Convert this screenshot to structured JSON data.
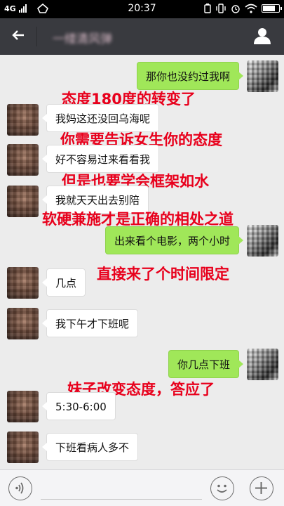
{
  "status_bar": {
    "network": "4G",
    "time": "20:37",
    "battery_level": 0.85
  },
  "header": {
    "title": "一缕清风弹",
    "back_icon": "back-arrow-icon",
    "profile_icon": "profile-icon"
  },
  "messages": [
    {
      "side": "self",
      "text": "那你也没约过我啊"
    },
    {
      "side": "other",
      "text": "我妈这还没回乌海呢"
    },
    {
      "side": "other",
      "text": "好不容易过来看看我"
    },
    {
      "side": "other",
      "text": "我就天天出去别陪"
    },
    {
      "side": "self",
      "text": "出来看个电影，两个小时"
    },
    {
      "side": "other",
      "text": "几点"
    },
    {
      "side": "other",
      "text": "我下午才下班呢"
    },
    {
      "side": "self",
      "text": "你几点下班"
    },
    {
      "side": "other",
      "text": "5:30-6:00"
    },
    {
      "side": "other",
      "text": "下班看病人多不"
    }
  ],
  "annotations": [
    "态度180度的转变了",
    "你需要告诉女生你的态度",
    "但是也要学会框架如水",
    "软硬兼施才是正确的相处之道",
    "直接来了个时间限定",
    "妹子改变态度，答应了"
  ],
  "input_bar": {
    "value": "",
    "voice_icon": "voice-icon",
    "emoji_icon": "emoji-icon",
    "plus_icon": "plus-icon"
  },
  "colors": {
    "header_bg": "#393a3f",
    "self_bubble": "#a0e759",
    "other_bubble": "#ffffff",
    "annotation": "#e8001c",
    "chat_bg": "#ececec"
  }
}
